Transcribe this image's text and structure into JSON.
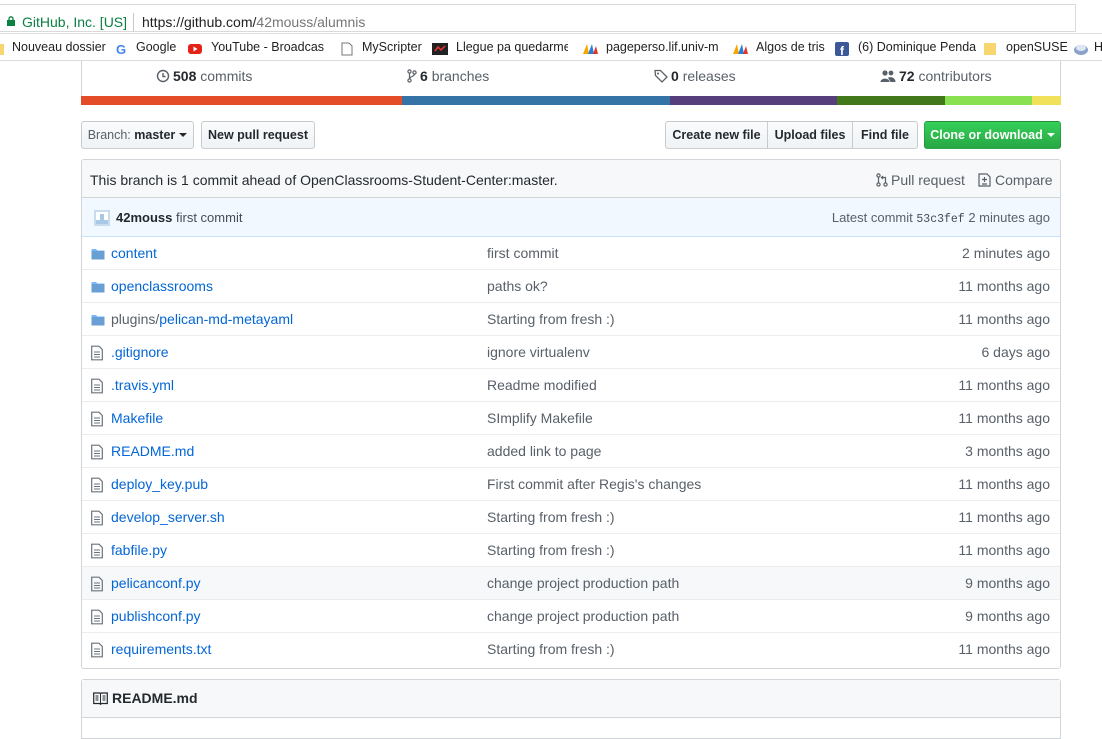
{
  "browser": {
    "site_identity": "GitHub, Inc. [US]",
    "url_prefix": "https://github.com/",
    "url_rest": "42mouss/alumnis"
  },
  "bookmarks": [
    {
      "label": "Nouveau dossier",
      "icon": "folder-icon"
    },
    {
      "label": "Google",
      "icon": "google-icon"
    },
    {
      "label": "YouTube - Broadcast",
      "icon": "youtube-icon"
    },
    {
      "label": "MyScripter",
      "icon": "page-icon"
    },
    {
      "label": "Llegue pa quedarme",
      "icon": "site-icon"
    },
    {
      "label": "pageperso.lif.univ-mr",
      "icon": "univ-icon"
    },
    {
      "label": "Algos de tris",
      "icon": "univ-icon"
    },
    {
      "label": "(6) Dominique Penda",
      "icon": "facebook-icon"
    },
    {
      "label": "openSUSE",
      "icon": "folder-icon"
    },
    {
      "label": "H",
      "icon": "site-icon"
    }
  ],
  "summary": {
    "commits_count": "508",
    "commits_label": "commits",
    "branches_count": "6",
    "branches_label": "branches",
    "releases_count": "0",
    "releases_label": "releases",
    "contributors_count": "72",
    "contributors_label": "contributors"
  },
  "languages": [
    {
      "color": "#e34c26",
      "share": 32.8
    },
    {
      "color": "#3572a5",
      "share": 27.3
    },
    {
      "color": "#563d7c",
      "share": 17.0
    },
    {
      "color": "#427819",
      "share": 11.1
    },
    {
      "color": "#89e051",
      "share": 8.8
    },
    {
      "color": "#f1e05a",
      "share": 3.0
    }
  ],
  "toolbar": {
    "branch_prefix": "Branch:",
    "branch_name": "master",
    "new_pr": "New pull request",
    "create_file": "Create new file",
    "upload_files": "Upload files",
    "find_file": "Find file",
    "clone": "Clone or download"
  },
  "ahead_bar": {
    "message": "This branch is 1 commit ahead of OpenClassrooms-Student-Center:master.",
    "pull_request": "Pull request",
    "compare": "Compare"
  },
  "latest_commit": {
    "author": "42mouss",
    "message": "first commit",
    "prefix": "Latest commit",
    "sha": "53c3fef",
    "age": "2 minutes ago"
  },
  "files": [
    {
      "type": "dir",
      "name": "content",
      "message": "first commit",
      "age": "2 minutes ago"
    },
    {
      "type": "dir",
      "name": "openclassrooms",
      "message": "paths ok?",
      "age": "11 months ago"
    },
    {
      "type": "dir",
      "prefix": "plugins/",
      "name": "pelican-md-metayaml",
      "message": "Starting from fresh :)",
      "age": "11 months ago"
    },
    {
      "type": "file",
      "name": ".gitignore",
      "message": "ignore virtualenv",
      "age": "6 days ago"
    },
    {
      "type": "file",
      "name": ".travis.yml",
      "message": "Readme modified",
      "age": "11 months ago"
    },
    {
      "type": "file",
      "name": "Makefile",
      "message": "SImplify Makefile",
      "age": "11 months ago"
    },
    {
      "type": "file",
      "name": "README.md",
      "message": "added link to page",
      "age": "3 months ago"
    },
    {
      "type": "file",
      "name": "deploy_key.pub",
      "message": "First commit after Regis's changes",
      "age": "11 months ago"
    },
    {
      "type": "file",
      "name": "develop_server.sh",
      "message": "Starting from fresh :)",
      "age": "11 months ago"
    },
    {
      "type": "file",
      "name": "fabfile.py",
      "message": "Starting from fresh :)",
      "age": "11 months ago"
    },
    {
      "type": "file",
      "name": "pelicanconf.py",
      "message": "change project production path",
      "age": "9 months ago",
      "highlight": true
    },
    {
      "type": "file",
      "name": "publishconf.py",
      "message": "change project production path",
      "age": "9 months ago"
    },
    {
      "type": "file",
      "name": "requirements.txt",
      "message": "Starting from fresh :)",
      "age": "11 months ago"
    }
  ],
  "readme": {
    "title": "README.md"
  }
}
